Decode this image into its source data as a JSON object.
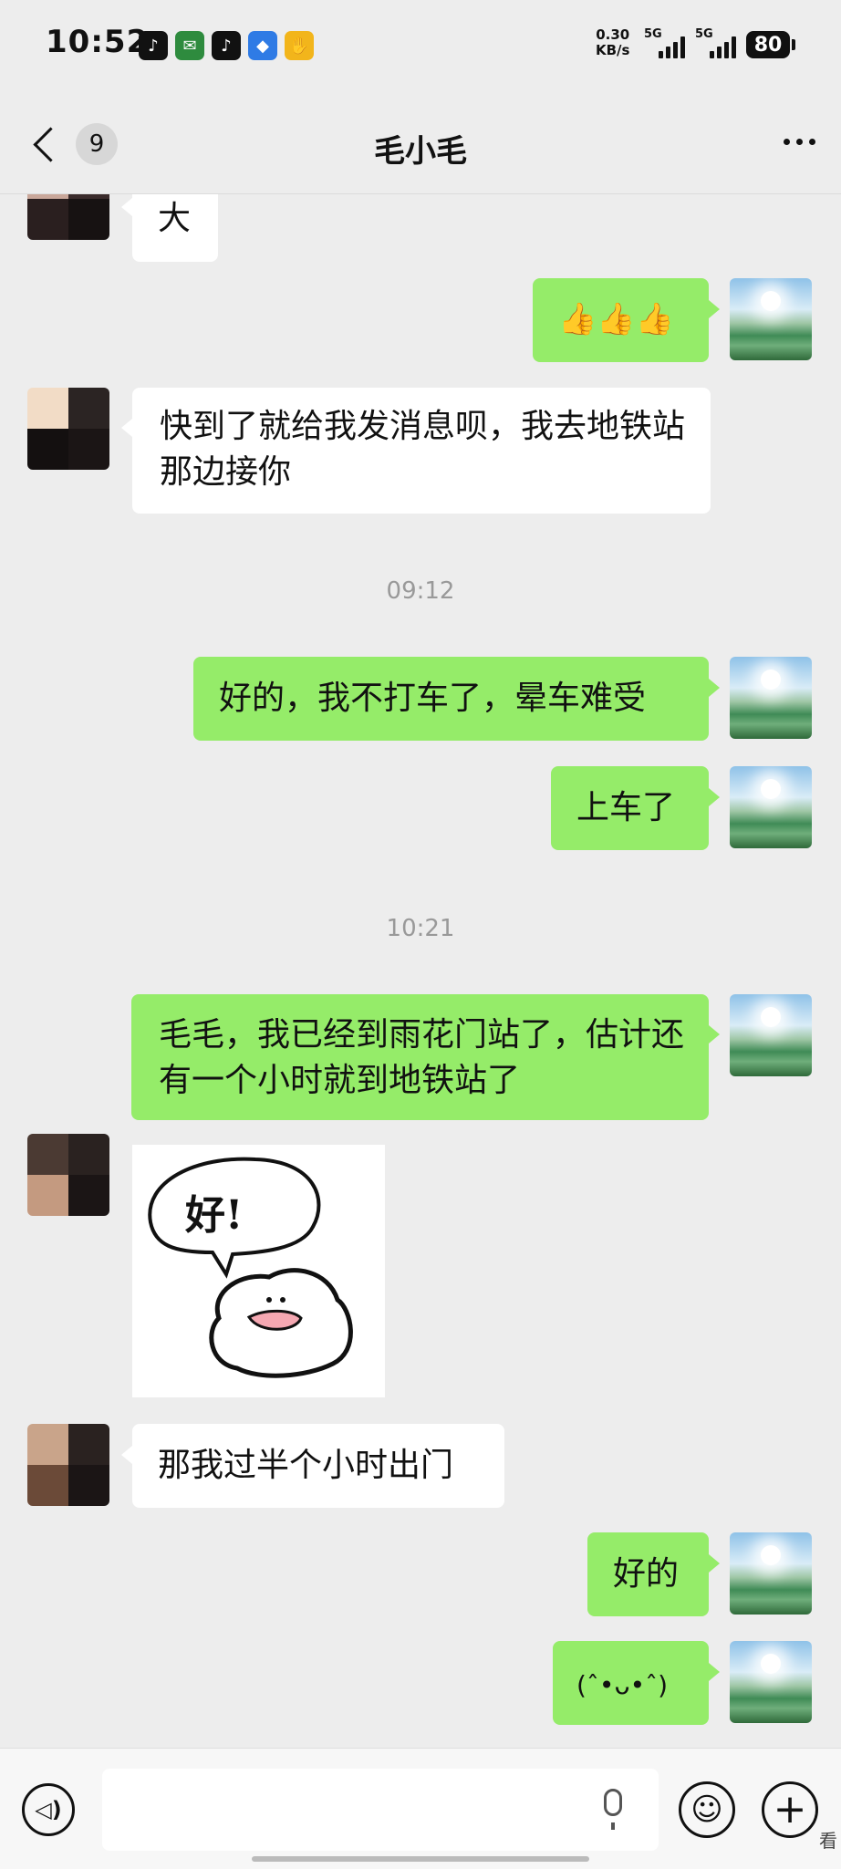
{
  "status_bar": {
    "time": "10:52",
    "net_speed_value": "0.30",
    "net_speed_unit": "KB/s",
    "signal1_label": "5G",
    "signal2_label": "5G",
    "battery": "80",
    "app_icons": [
      "douyin-icon",
      "post-icon",
      "douyin-icon",
      "message-icon",
      "notification-icon"
    ]
  },
  "header": {
    "back_unread_count": "9",
    "title": "毛小毛"
  },
  "messages": [
    {
      "side": "in",
      "text": "大"
    },
    {
      "side": "out",
      "text": "👍👍👍"
    },
    {
      "side": "in",
      "text": "快到了就给我发消息呗，我去地铁站那边接你"
    },
    {
      "side": "timestamp",
      "text": "09:12"
    },
    {
      "side": "out",
      "text": "好的，我不打车了，晕车难受"
    },
    {
      "side": "out",
      "text": "上车了"
    },
    {
      "side": "timestamp",
      "text": "10:21"
    },
    {
      "side": "out",
      "text": "毛毛，我已经到雨花门站了，估计还有一个小时就到地铁站了"
    },
    {
      "side": "in",
      "type": "sticker",
      "text": "好!"
    },
    {
      "side": "in",
      "text": "那我过半个小时出门"
    },
    {
      "side": "out",
      "text": "好的"
    },
    {
      "side": "out",
      "text": "(ˆ•ᴗ•ˆ)"
    }
  ],
  "input_bar": {
    "placeholder": "",
    "corner_text": "看"
  },
  "colors": {
    "background": "#ededed",
    "bubble_out": "#95ec69",
    "bubble_in": "#ffffff"
  }
}
